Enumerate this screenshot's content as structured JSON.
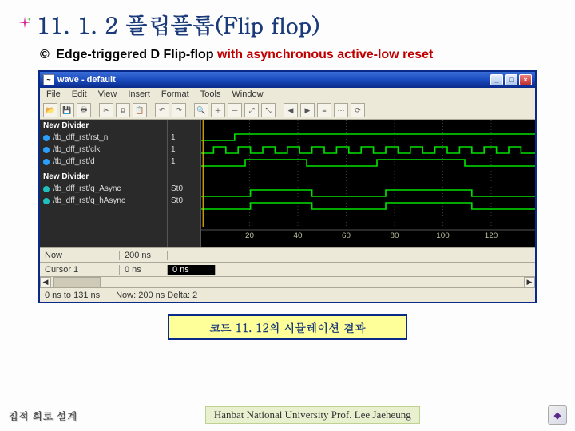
{
  "slide": {
    "section_number": "11. 1. 2",
    "title_ko": "플립플롭",
    "title_en": "(Flip flop)",
    "subtitle_black": "Edge-triggered D Flip-flop",
    "subtitle_red": " with asynchronous active-low reset",
    "caption": "코드 11. 12의 시뮬레이션 결과"
  },
  "window": {
    "title": "wave - default",
    "btn_min": "_",
    "btn_max": "□",
    "btn_close": "×",
    "menu": [
      "File",
      "Edit",
      "View",
      "Insert",
      "Format",
      "Tools",
      "Window"
    ]
  },
  "signals": {
    "group1": "New Divider",
    "items1": [
      {
        "name": "/tb_dff_rst/rst_n",
        "val": "1"
      },
      {
        "name": "/tb_dff_rst/clk",
        "val": "1"
      },
      {
        "name": "/tb_dff_rst/d",
        "val": "1"
      }
    ],
    "group2": "New Divider",
    "items2": [
      {
        "name": "/tb_dff_rst/q_Async",
        "val": "St0"
      },
      {
        "name": "/tb_dff_rst/q_hAsync",
        "val": "St0"
      }
    ]
  },
  "axis": {
    "ticks": [
      "20",
      "40",
      "60",
      "80",
      "100",
      "120"
    ]
  },
  "bottom": {
    "now_label": "Now",
    "now_a": "200 ns",
    "now_b": "",
    "cur_label": "Cursor 1",
    "cur_a": "0 ns",
    "cur_b": "0 ns",
    "status_left": "0 ns to 131 ns",
    "status_mid": "Now: 200 ns  Delta: 2"
  },
  "footer": {
    "left": "집적 회로 설계",
    "mid": "Hanbat National University Prof. Lee Jaeheung",
    "logo": "◆"
  }
}
